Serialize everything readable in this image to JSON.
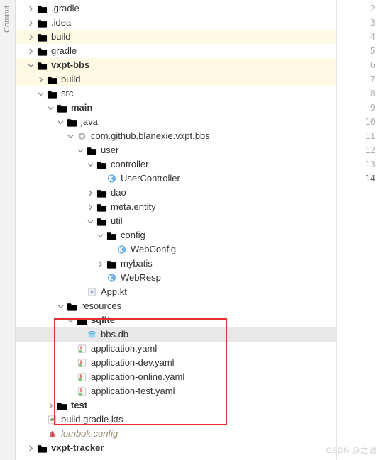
{
  "gutter": {
    "label": "Commit"
  },
  "watermark": "CSDN @之诚",
  "lines": [
    "2",
    "3",
    "4",
    "5",
    "6",
    "7",
    "8",
    "9",
    "10",
    "11",
    "12",
    "13",
    "14"
  ],
  "active_line": "14",
  "tree": {
    "n0": ".gradle",
    "n1": ".idea",
    "n2": "build",
    "n3": "gradle",
    "n4": "vxpt-bbs",
    "n5": "build",
    "n6": "src",
    "n7": "main",
    "n8": "java",
    "n9": "com.github.blanexie.vxpt.bbs",
    "n10": "user",
    "n11": "controller",
    "n12": "UserController",
    "n13": "dao",
    "n14": "meta.entity",
    "n15": "util",
    "n16": "config",
    "n17": "WebConfig",
    "n18": "mybatis",
    "n19": "WebResp",
    "n20": "App.kt",
    "n21": "resources",
    "n22": "sqlite",
    "n23": "bbs.db",
    "n24": "application.yaml",
    "n25": "application-dev.yaml",
    "n26": "application-online.yaml",
    "n27": "application-test.yaml",
    "n28": "test",
    "n29": "build.gradle.kts",
    "n30": "lombok.config",
    "n31": "vxpt-tracker"
  }
}
